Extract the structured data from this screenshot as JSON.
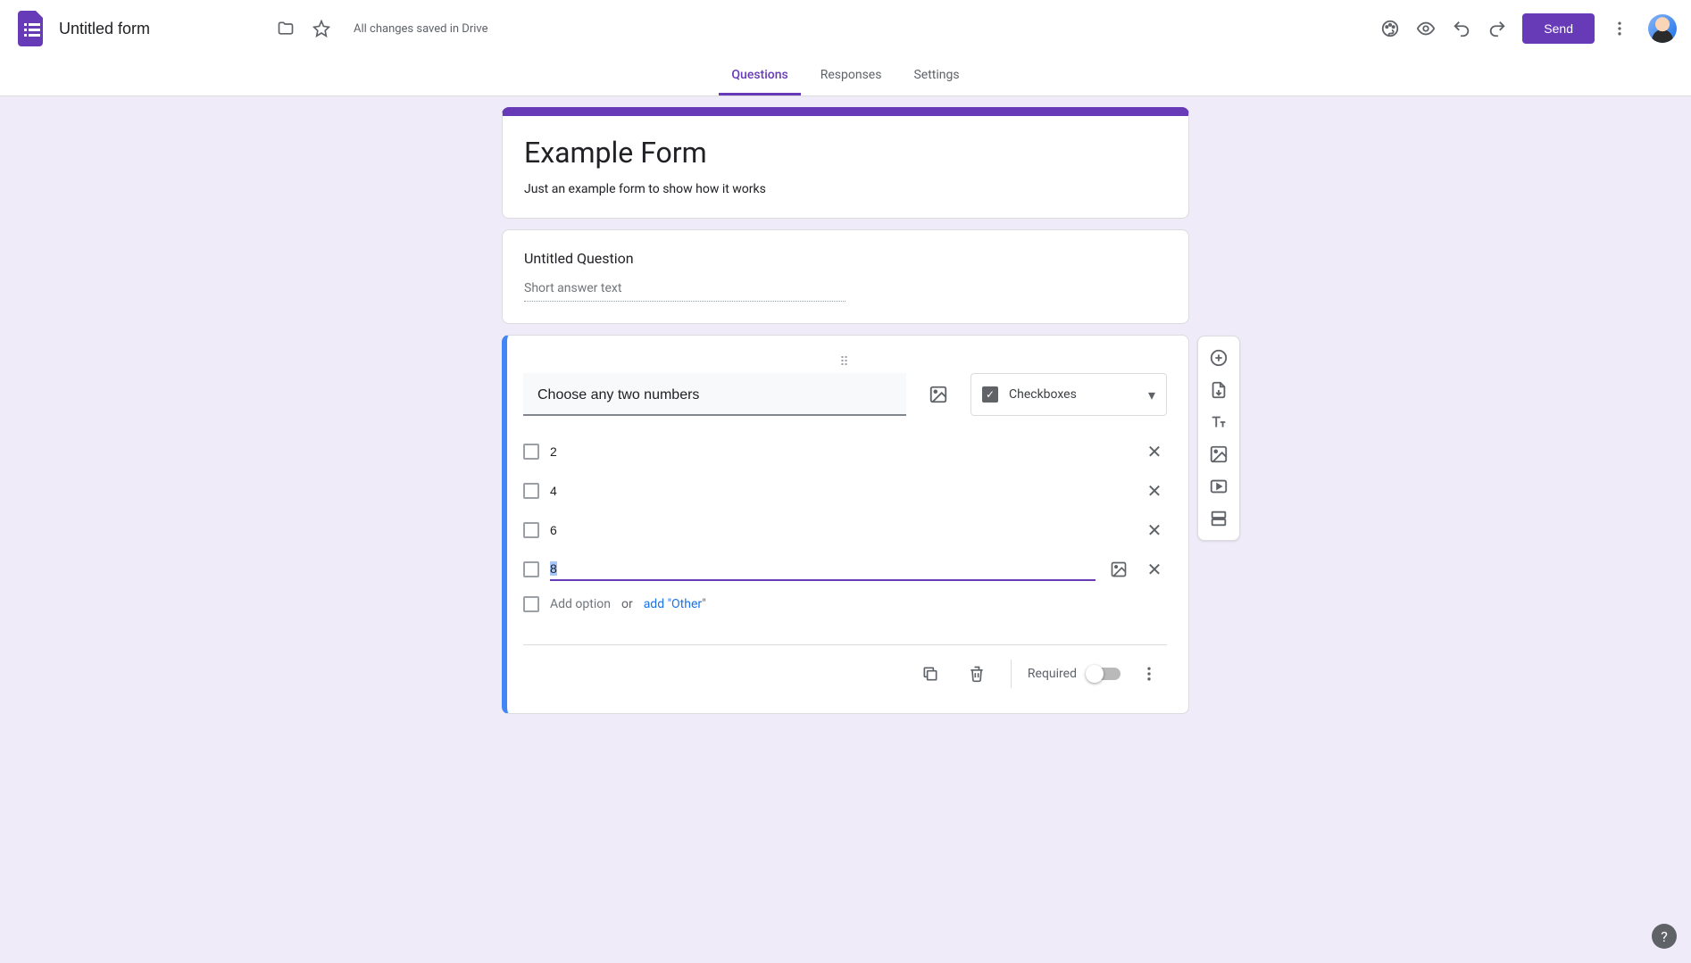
{
  "header": {
    "form_title": "Untitled form",
    "save_status": "All changes saved in Drive",
    "send_label": "Send"
  },
  "tabs": {
    "questions": "Questions",
    "responses": "Responses",
    "settings": "Settings",
    "active": "questions"
  },
  "form": {
    "title": "Example Form",
    "description": "Just an example form to show how it works"
  },
  "questions": [
    {
      "title": "Untitled Question",
      "type_label": "Short answer text"
    },
    {
      "title": "Choose any two numbers",
      "type_label": "Checkboxes",
      "options": [
        "2",
        "4",
        "6",
        "8"
      ],
      "editing_index": 3,
      "add_option_placeholder": "Add option",
      "add_option_or": "or",
      "add_other_label": "add \"Other\"",
      "required_label": "Required",
      "required": false
    }
  ],
  "colors": {
    "primary": "#673ab7",
    "accent_blue": "#4285f4",
    "canvas_bg": "#f0ebf8"
  }
}
